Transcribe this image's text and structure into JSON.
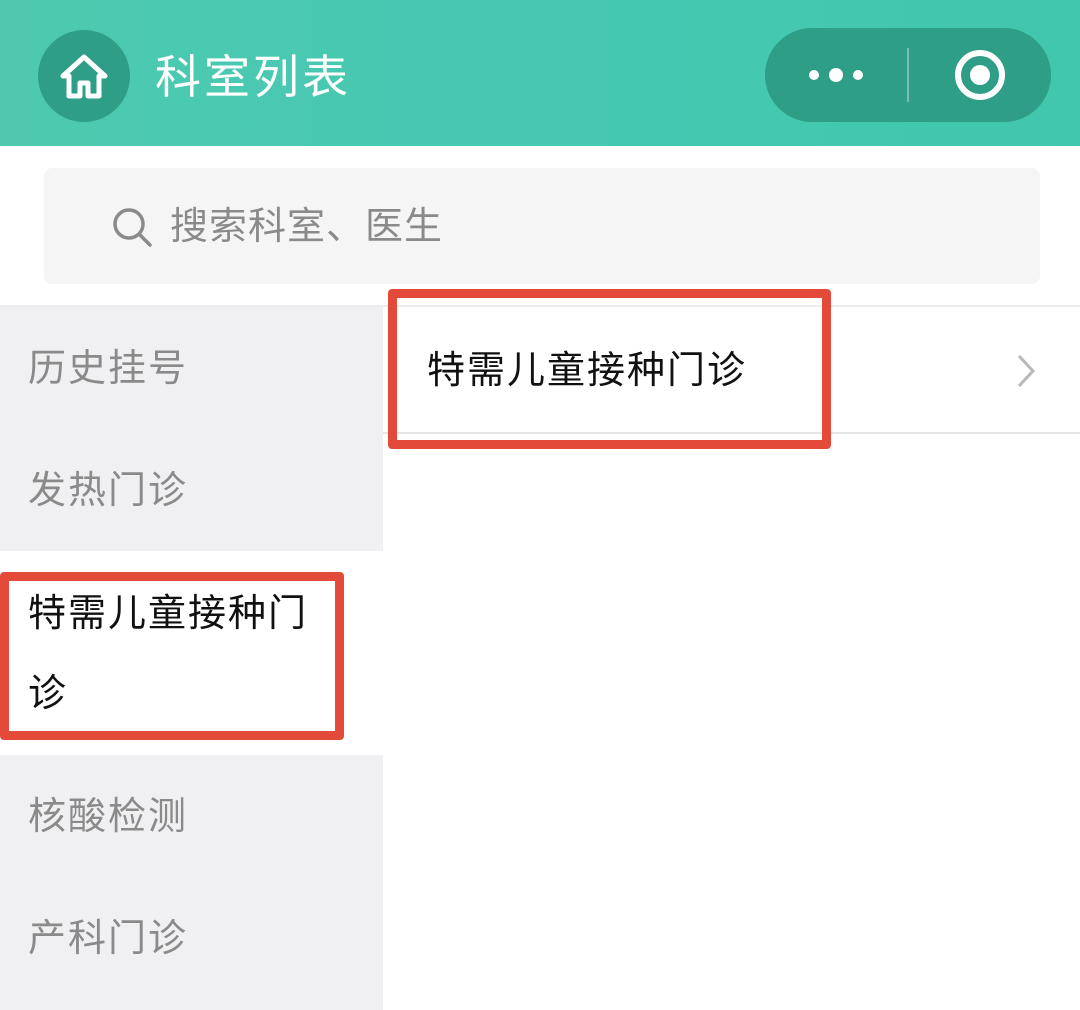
{
  "header": {
    "title": "科室列表",
    "home_icon": "home-icon",
    "more_icon": "more-dots-icon",
    "close_icon": "target-close-icon",
    "bg_color": "#46c8b2",
    "button_color": "#2f9e86"
  },
  "search": {
    "placeholder": "搜索科室、医生",
    "icon": "search-icon"
  },
  "sidebar": {
    "items": [
      {
        "label": "历史挂号",
        "active": false
      },
      {
        "label": "发热门诊",
        "active": false
      },
      {
        "label": "特需儿童接种门诊",
        "active": true
      },
      {
        "label": "核酸检测",
        "active": false
      },
      {
        "label": "产科门诊",
        "active": false
      }
    ]
  },
  "departments": [
    {
      "name": "特需儿童接种门诊",
      "icon": "chevron-right-icon"
    }
  ],
  "annotations": {
    "highlight_color": "#e44a3a"
  }
}
